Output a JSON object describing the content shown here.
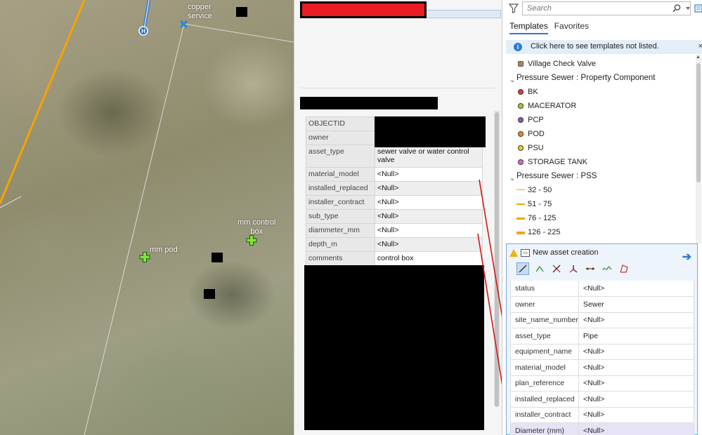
{
  "map": {
    "labels": {
      "copper_service": "copper\nservice",
      "mm_pod": "mm pod",
      "mm_control_box": "mm control\nbox",
      "hydrant_marker": "H"
    }
  },
  "popup": {
    "attributes": [
      {
        "key": "OBJECTID",
        "value": ""
      },
      {
        "key": "owner",
        "value": ""
      },
      {
        "key": "asset_type",
        "value": "sewer valve or water control valve"
      },
      {
        "key": "material_model",
        "value": "<Null>"
      },
      {
        "key": "installed_replaced",
        "value": "<Null>"
      },
      {
        "key": "installer_contract",
        "value": "<Null>"
      },
      {
        "key": "sub_type",
        "value": "<Null>"
      },
      {
        "key": "diammeter_mm",
        "value": "<Null>"
      },
      {
        "key": "depth_m",
        "value": "<Null>"
      },
      {
        "key": "comments",
        "value": "control box"
      }
    ]
  },
  "templates_pane": {
    "search_placeholder": "Search",
    "tabs": [
      "Templates",
      "Favorites"
    ],
    "info_text": "Click here to see templates not listed.",
    "close_glyph": "×",
    "items": {
      "village_check_valve": "Village Check Valve",
      "group_property_component": "Pressure Sewer : Property Component",
      "bk": "BK",
      "macerator": "MACERATOR",
      "pcp": "PCP",
      "pod": "POD",
      "psu": "PSU",
      "storage_tank": "STORAGE TANK",
      "group_pss": "Pressure Sewer : PSS",
      "pss_1": "32 - 50",
      "pss_2": "51 - 75",
      "pss_3": "76 - 125",
      "pss_4": "126 - 225"
    },
    "colors": {
      "bk": "#e23b3b",
      "macerator": "#b3c42a",
      "pcp": "#9a4fb5",
      "pod": "#f08a24",
      "psu": "#f2d21c",
      "storage_tank": "#d46bd0",
      "pss_line": "#f2a400"
    }
  },
  "creation": {
    "title": "New asset creation",
    "fields": [
      {
        "key": "status",
        "value": "<Null>"
      },
      {
        "key": "owner",
        "value": "Sewer"
      },
      {
        "key": "site_name_number",
        "value": "<Null>"
      },
      {
        "key": "asset_type",
        "value": "Pipe"
      },
      {
        "key": "equipment_name",
        "value": "<Null>"
      },
      {
        "key": "material_model",
        "value": "<Null>"
      },
      {
        "key": "plan_reference",
        "value": "<Null>"
      },
      {
        "key": "installed_replaced",
        "value": "<Null>"
      },
      {
        "key": "installer_contract",
        "value": "<Null>"
      },
      {
        "key": "Diameter (mm)",
        "value": "<Null>"
      }
    ]
  }
}
